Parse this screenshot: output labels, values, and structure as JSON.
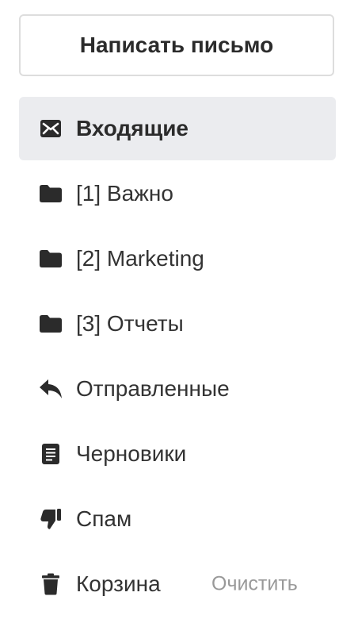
{
  "compose": {
    "label": "Написать письмо"
  },
  "folders": [
    {
      "label": "Входящие",
      "icon": "inbox-envelope-icon",
      "active": true
    },
    {
      "label": "[1] Важно",
      "icon": "folder-icon"
    },
    {
      "label": "[2] Marketing",
      "icon": "folder-icon"
    },
    {
      "label": "[3] Отчеты",
      "icon": "folder-icon"
    },
    {
      "label": "Отправленные",
      "icon": "reply-arrow-icon"
    },
    {
      "label": "Черновики",
      "icon": "document-icon"
    },
    {
      "label": "Спам",
      "icon": "thumbs-down-icon"
    },
    {
      "label": "Корзина",
      "icon": "trash-icon",
      "action": "Очистить"
    }
  ],
  "colors": {
    "active_background": "#ebecef",
    "text": "#333333",
    "muted_text": "#999999",
    "border": "#dddddd"
  }
}
